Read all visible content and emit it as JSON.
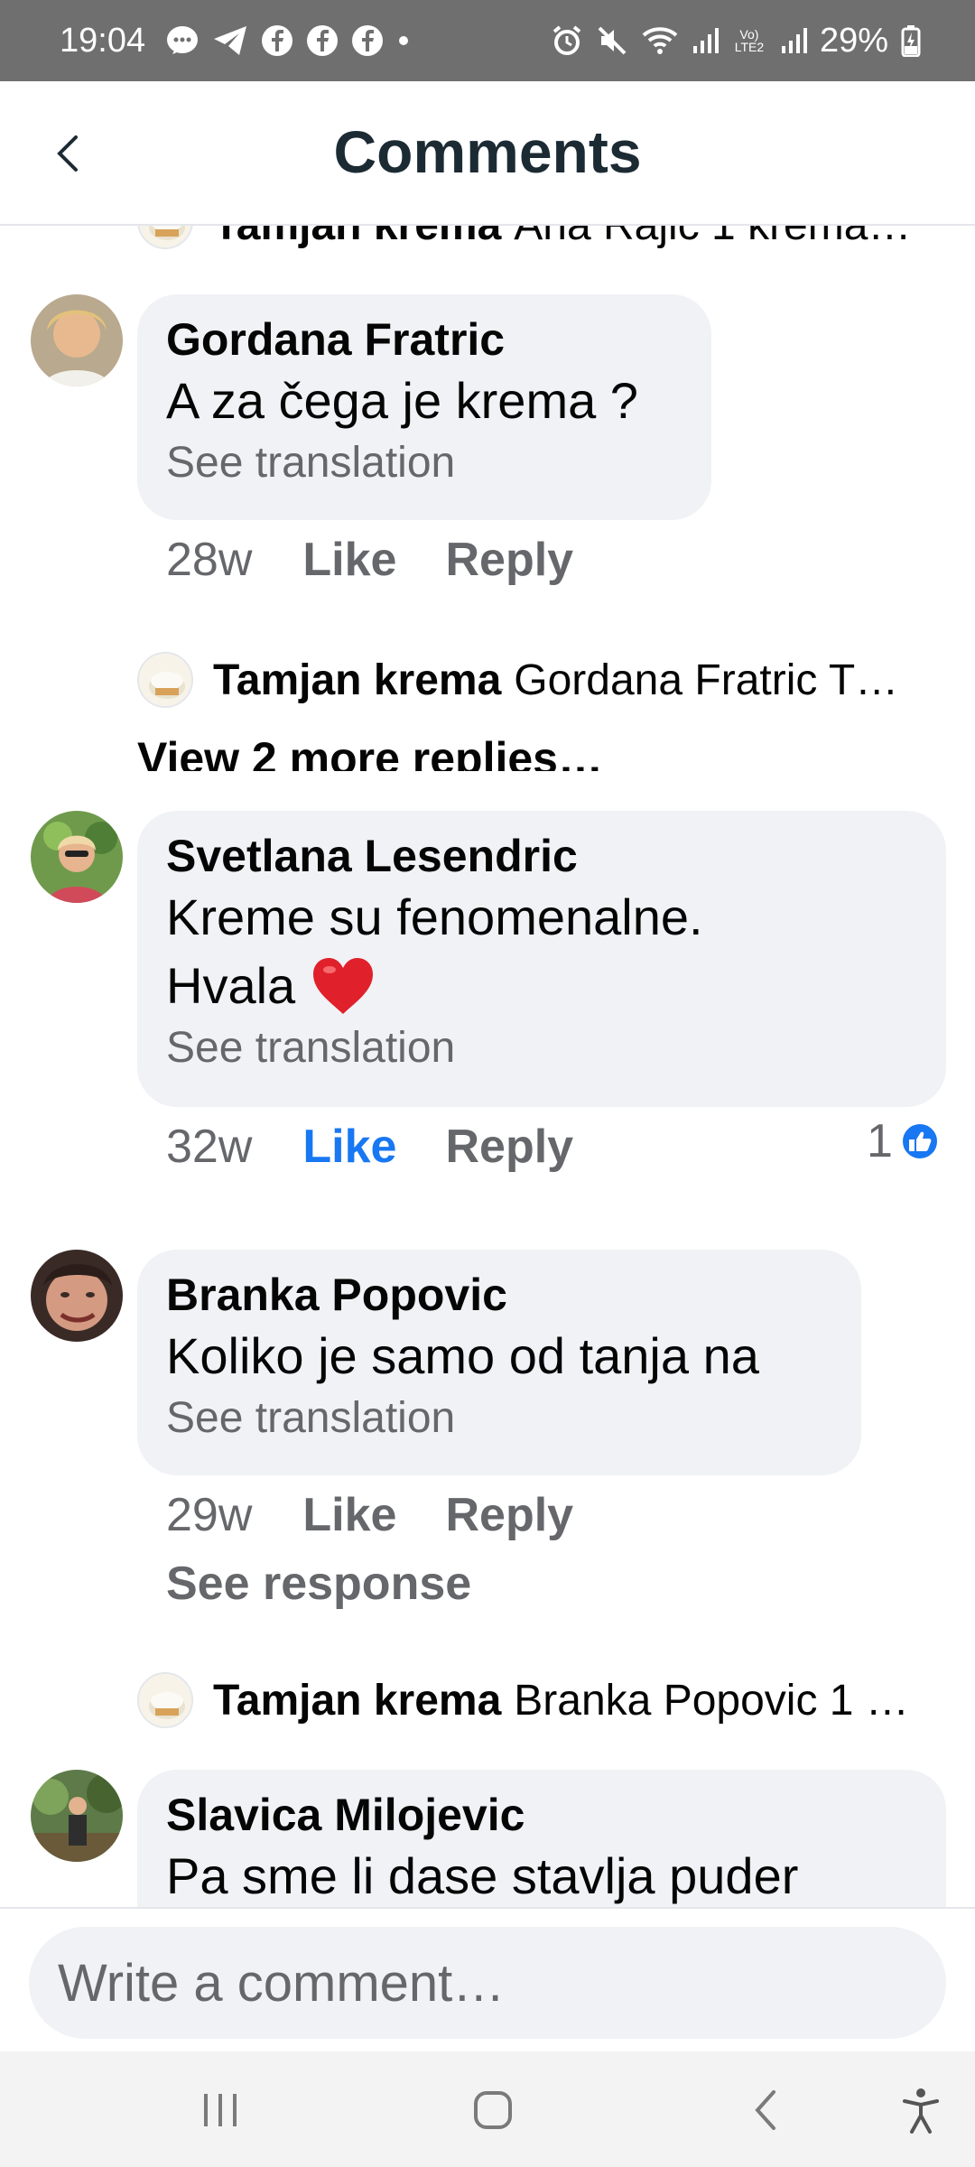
{
  "status_bar": {
    "time": "19:04",
    "battery": "29%",
    "volte_label": "Vo) LTE2"
  },
  "header": {
    "title": "Comments"
  },
  "thread": {
    "top_reply": {
      "name": "Tamjan krema",
      "text": "Ana Rajic 1 krema…"
    },
    "comments": [
      {
        "author": "Gordana Fratric",
        "text": "A za čega je krema ?",
        "see_translation": "See translation",
        "time": "28w",
        "like": "Like",
        "reply": "Reply",
        "reply_preview": {
          "name": "Tamjan krema",
          "text": "Gordana Fratric T…"
        },
        "view_more": "View 2 more replies…"
      },
      {
        "author": "Svetlana Lesendric",
        "text_line1": "Kreme su fenomenalne.",
        "text_line2": "Hvala",
        "emoji": "heart",
        "see_translation": "See translation",
        "time": "32w",
        "like": "Like",
        "reply": "Reply",
        "reaction_count": "1",
        "liked": true
      },
      {
        "author": "Branka Popovic",
        "text": "Koliko je samo od tanja na",
        "see_translation": "See translation",
        "time": "29w",
        "like": "Like",
        "reply": "Reply",
        "see_response": "See response",
        "reply_preview": {
          "name": "Tamjan krema",
          "text": "Branka Popovic 1 …"
        }
      },
      {
        "author": "Slavica Milojevic",
        "text": "Pa sme li dase stavlja puder"
      }
    ]
  },
  "composer": {
    "placeholder": "Write a comment…"
  },
  "colors": {
    "accent": "#1877f2",
    "bubble": "#f0f2f5",
    "secondary_text": "#65676b",
    "status_bar": "#6f6f6f"
  }
}
